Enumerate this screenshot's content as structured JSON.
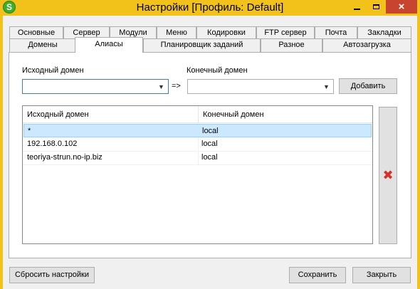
{
  "window": {
    "title": "Настройки [Профиль: Default]",
    "app_icon_letter": "S",
    "close_glyph": "×",
    "frame_color": "#f2c21a",
    "close_color": "#c7452e"
  },
  "tabs": {
    "row_back": [
      "Основные",
      "Сервер",
      "Модули",
      "Меню",
      "Кодировки",
      "FTP сервер",
      "Почта",
      "Закладки"
    ],
    "row_front": [
      "Домены",
      "Алиасы",
      "Планировщик заданий",
      "Разное",
      "Автозагрузка"
    ],
    "active": "Алиасы"
  },
  "aliases": {
    "source_label": "Исходный домен",
    "target_label": "Конечный домен",
    "source_value": "",
    "target_value": "",
    "arrow_text": "=>",
    "add_button": "Добавить",
    "list": {
      "columns": [
        "Исходный домен",
        "Конечный домен"
      ],
      "rows": [
        {
          "source": "*",
          "target": "local",
          "selected": true
        },
        {
          "source": "192.168.0.102",
          "target": "local",
          "selected": false
        },
        {
          "source": "teoriya-strun.no-ip.biz",
          "target": "local",
          "selected": false
        }
      ]
    },
    "delete_icon": "delete-x-icon",
    "delete_glyph": "✖",
    "delete_color": "#d6302b"
  },
  "footer": {
    "reset_button": "Сбросить настройки",
    "save_button": "Сохранить",
    "close_button": "Закрыть"
  }
}
